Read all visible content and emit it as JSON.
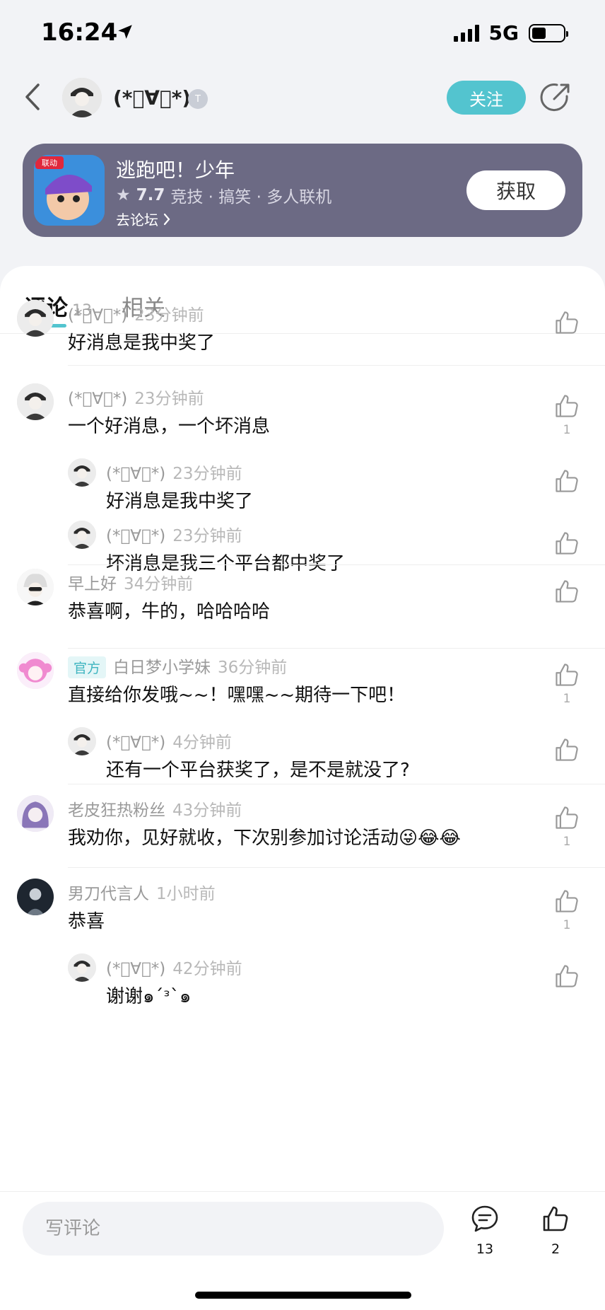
{
  "status": {
    "time": "16:24",
    "network": "5G"
  },
  "nav": {
    "username": "(*ﾟ∀ﾟ*)",
    "level": "T",
    "follow_label": "关注"
  },
  "game": {
    "badge": "联动",
    "title": "逃跑吧！少年",
    "rating": "7.7",
    "tags": "竞技 · 搞笑 · 多人联机",
    "forum_link": "去论坛",
    "get_label": "获取"
  },
  "tabs": {
    "comments_label": "评论",
    "comments_count": "13",
    "related_label": "相关"
  },
  "comments": [
    {
      "user": "(*ﾟ∀ﾟ*)",
      "time": "23分钟前",
      "text": "好消息是我中奖了",
      "likes": ""
    },
    {
      "user": "(*ﾟ∀ﾟ*)",
      "time": "23分钟前",
      "text": "一个好消息，一个坏消息",
      "likes": "1",
      "replies": [
        {
          "user": "(*ﾟ∀ﾟ*)",
          "time": "23分钟前",
          "text": "好消息是我中奖了",
          "likes": ""
        },
        {
          "user": "(*ﾟ∀ﾟ*)",
          "time": "23分钟前",
          "text": "坏消息是我三个平台都中奖了",
          "likes": ""
        }
      ]
    },
    {
      "user": "早上好",
      "time": "34分钟前",
      "text": "恭喜啊，牛的，哈哈哈哈",
      "likes": ""
    },
    {
      "badge": "官方",
      "user": "白日梦小学妹",
      "time": "36分钟前",
      "text": "直接给你发哦~~！嘿嘿~~期待一下吧！",
      "likes": "1",
      "replies": [
        {
          "user": "(*ﾟ∀ﾟ*)",
          "time": "4分钟前",
          "text": "还有一个平台获奖了，是不是就没了?",
          "likes": ""
        }
      ]
    },
    {
      "user": "老皮狂热粉丝",
      "time": "43分钟前",
      "text": "我劝你，见好就收，下次别参加讨论活动😜😂😂",
      "likes": "1"
    },
    {
      "user": "男刀代言人",
      "time": "1小时前",
      "text": "恭喜",
      "likes": "1",
      "replies": [
        {
          "user": "(*ﾟ∀ﾟ*)",
          "time": "42分钟前",
          "text": "谢谢๑´ᵌ`๑",
          "likes": ""
        }
      ]
    }
  ],
  "bottom": {
    "input_placeholder": "写评论",
    "comment_count": "13",
    "like_count": "2"
  },
  "colors": {
    "accent": "#53c4cf",
    "game_card": "#6c6a84"
  }
}
